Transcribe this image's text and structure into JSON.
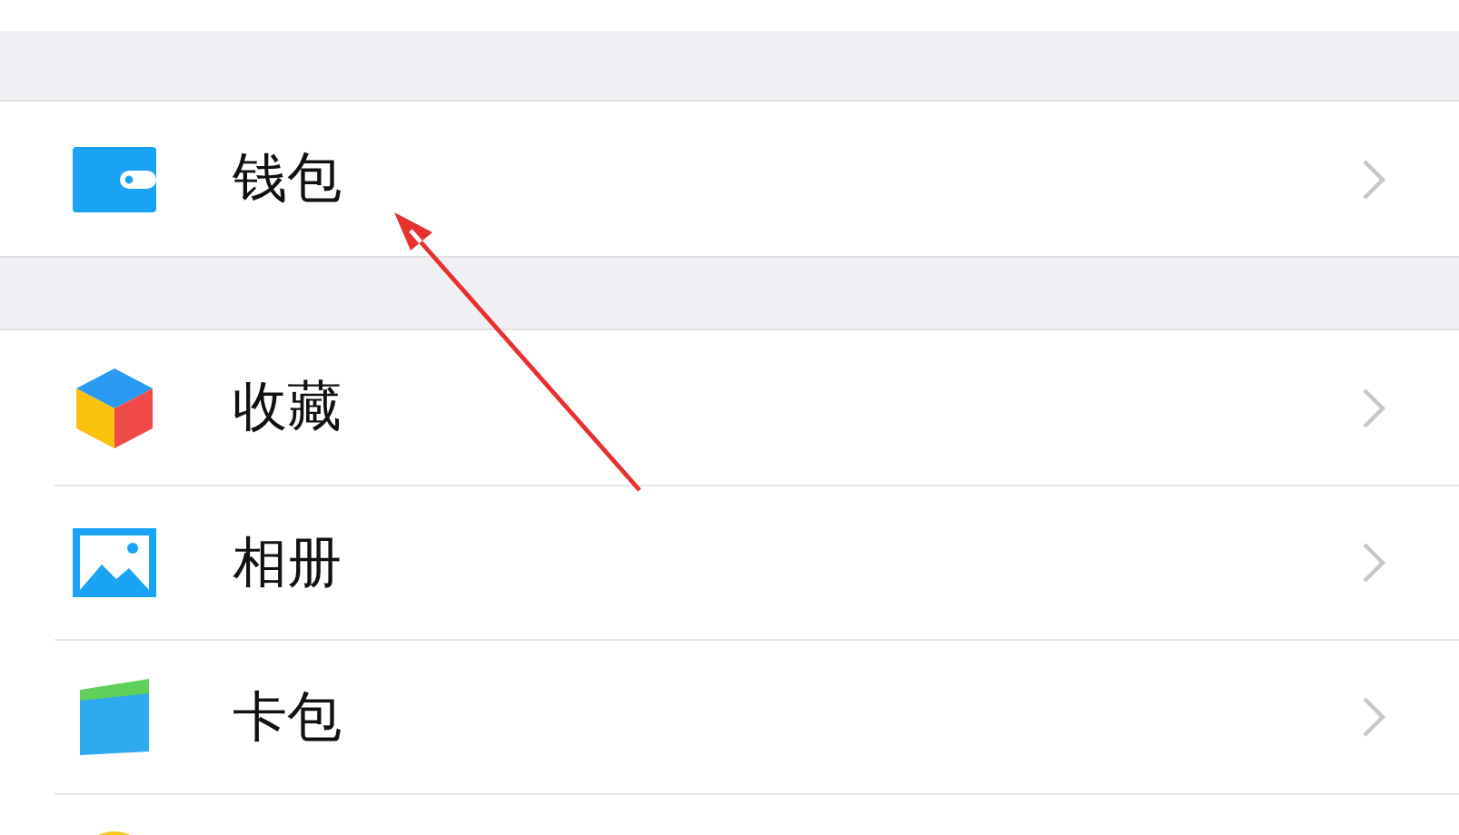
{
  "groups": [
    {
      "items": [
        {
          "kind": "wallet",
          "label": "钱包"
        }
      ]
    },
    {
      "items": [
        {
          "kind": "favorites",
          "label": "收藏"
        },
        {
          "kind": "album",
          "label": "相册"
        },
        {
          "kind": "cards",
          "label": "卡包"
        },
        {
          "kind": "emoji"
        }
      ]
    }
  ]
}
